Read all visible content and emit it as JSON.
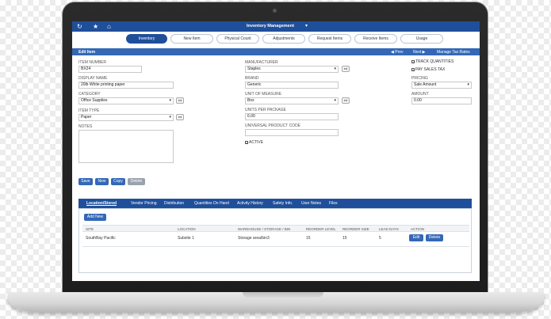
{
  "app": {
    "title": "Inventory Management",
    "icons": [
      "history-icon",
      "star-icon",
      "home-icon"
    ]
  },
  "tabs": [
    {
      "label": "Inventory",
      "active": true
    },
    {
      "label": "New Item",
      "active": false
    },
    {
      "label": "Physical Count",
      "active": false
    },
    {
      "label": "Adjustments",
      "active": false
    },
    {
      "label": "Request Items",
      "active": false
    },
    {
      "label": "Receive Items",
      "active": false
    },
    {
      "label": "Usage",
      "active": false
    }
  ],
  "edit": {
    "title": "Edit Item",
    "prev": "◀ Prev",
    "next": "Next ▶",
    "manage_tax": "Manage Tax Rates"
  },
  "form": {
    "item_number_label": "Item Number",
    "item_number": "BX24",
    "display_name_label": "Display Name",
    "display_name": "20lb White printing paper",
    "category_label": "Category",
    "category": "Office Supplies",
    "item_type_label": "Item Type",
    "item_type": "Paper",
    "notes_label": "Notes",
    "manufacturer_label": "Manufacturer",
    "manufacturer": "Staples",
    "brand_label": "Brand",
    "brand": "Generic",
    "unit_label": "Unit of Measure",
    "unit": "Box",
    "units_per_package_label": "Units per Package",
    "units_per_package": "6.00",
    "upc_label": "Universal Product Code",
    "upc": "",
    "active_label": "Active",
    "track_quantities_label": "Track Quantities",
    "pay_sales_tax_label": "Pay Sales Tax",
    "pricing_label": "Pricing",
    "pricing": "Sale Amount",
    "amount_label": "Amount",
    "amount": "0.00",
    "edit_mini": "ed"
  },
  "actions": {
    "save": "Save",
    "new": "New",
    "copy": "Copy",
    "delete": "Delete"
  },
  "lower_tabs": [
    {
      "label": "Location/Stored",
      "active": true
    },
    {
      "label": "Vendor Pricing",
      "active": false
    },
    {
      "label": "Distribution",
      "active": false
    },
    {
      "label": "Quantities On Hand",
      "active": false
    },
    {
      "label": "Activity History",
      "active": false
    },
    {
      "label": "Safety Info.",
      "active": false
    },
    {
      "label": "User Notes",
      "active": false
    },
    {
      "label": "Files",
      "active": false
    }
  ],
  "locations": {
    "add_new": "Add New",
    "columns": [
      "Site",
      "Location",
      "Warehouse / Storage / Bin",
      "Reorder Level",
      "Reorder Size",
      "Lead Days",
      "Action"
    ],
    "rows": [
      {
        "site": "SouthBay Pacific",
        "location": "Subsite 1",
        "warehouse": "Storage area/bin3",
        "reorder_level": "15",
        "reorder_size": "15",
        "lead_days": "5",
        "edit": "Edit",
        "delete": "Delete"
      }
    ]
  }
}
